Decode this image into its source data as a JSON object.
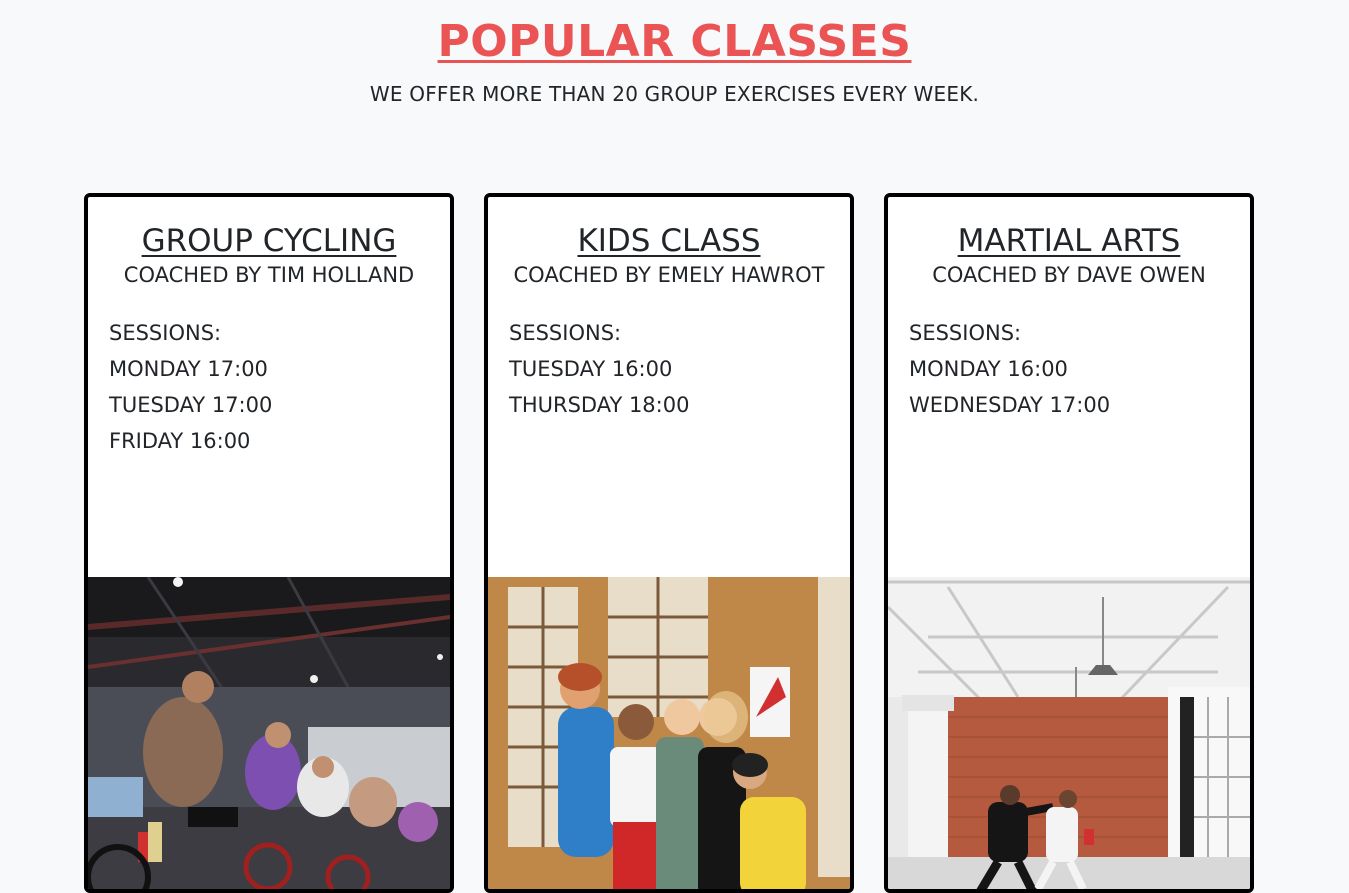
{
  "header": {
    "title": "POPULAR CLASSES",
    "subtitle": "WE OFFER MORE THAN 20 GROUP EXERCISES EVERY WEEK."
  },
  "classes": [
    {
      "title": "GROUP CYCLING",
      "coach": "COACHED BY TIM HOLLAND",
      "sessions_label": "SESSIONS:",
      "sessions": [
        "MONDAY 17:00",
        "TUESDAY 17:00",
        "FRIDAY 16:00"
      ],
      "image": "group-cycling-photo"
    },
    {
      "title": "KIDS CLASS",
      "coach": "COACHED BY EMELY HAWROT",
      "sessions_label": "SESSIONS:",
      "sessions": [
        "TUESDAY 16:00",
        "THURSDAY 18:00"
      ],
      "image": "kids-class-photo"
    },
    {
      "title": "MARTIAL ARTS",
      "coach": "COACHED BY DAVE OWEN",
      "sessions_label": "SESSIONS:",
      "sessions": [
        "MONDAY 16:00",
        "WEDNESDAY 17:00"
      ],
      "image": "martial-arts-photo"
    }
  ],
  "colors": {
    "accent": "#ea5455",
    "background": "#f8f9fa",
    "card_border": "#000000"
  }
}
